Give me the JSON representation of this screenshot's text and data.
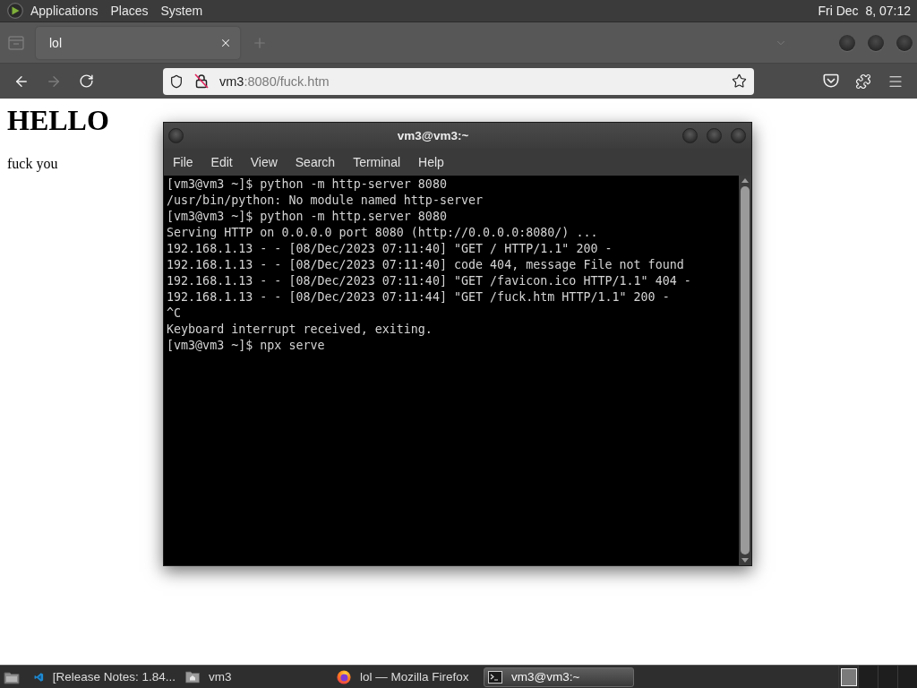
{
  "top_panel": {
    "menus": [
      "Applications",
      "Places",
      "System"
    ],
    "clock": "Fri Dec  8, 07:12"
  },
  "browser": {
    "tabs": [
      {
        "title": "lol",
        "selected": true
      }
    ],
    "nav_buttons": [
      {
        "kind": "back",
        "disabled": false
      },
      {
        "kind": "forward",
        "disabled": true
      },
      {
        "kind": "reload",
        "disabled": false
      }
    ],
    "url": {
      "host": "vm3",
      "path": ":8080/fuck.htm"
    },
    "page": {
      "heading": "HELLO",
      "paragraph": "fuck you"
    }
  },
  "terminal": {
    "title": "vm3@vm3:~",
    "menus": [
      "File",
      "Edit",
      "View",
      "Search",
      "Terminal",
      "Help"
    ],
    "lines": [
      "[vm3@vm3 ~]$ python -m http-server 8080",
      "/usr/bin/python: No module named http-server",
      "[vm3@vm3 ~]$ python -m http.server 8080",
      "Serving HTTP on 0.0.0.0 port 8080 (http://0.0.0.0:8080/) ...",
      "192.168.1.13 - - [08/Dec/2023 07:11:40] \"GET / HTTP/1.1\" 200 -",
      "192.168.1.13 - - [08/Dec/2023 07:11:40] code 404, message File not found",
      "192.168.1.13 - - [08/Dec/2023 07:11:40] \"GET /favicon.ico HTTP/1.1\" 404 -",
      "192.168.1.13 - - [08/Dec/2023 07:11:44] \"GET /fuck.htm HTTP/1.1\" 200 -",
      "^C",
      "Keyboard interrupt received, exiting.",
      "[vm3@vm3 ~]$ npx serve"
    ]
  },
  "taskbar": {
    "items": [
      {
        "kind": "editor",
        "label": "[Release Notes: 1.84...",
        "selected": false
      },
      {
        "kind": "folder",
        "label": "vm3",
        "selected": false
      },
      {
        "kind": "browser",
        "label": "lol — Mozilla Firefox",
        "selected": false
      },
      {
        "kind": "terminal",
        "label": "vm3@vm3:~",
        "selected": true
      }
    ],
    "workspaces": [
      {
        "selected": true
      },
      {
        "selected": false
      },
      {
        "selected": false
      },
      {
        "selected": false
      }
    ]
  }
}
